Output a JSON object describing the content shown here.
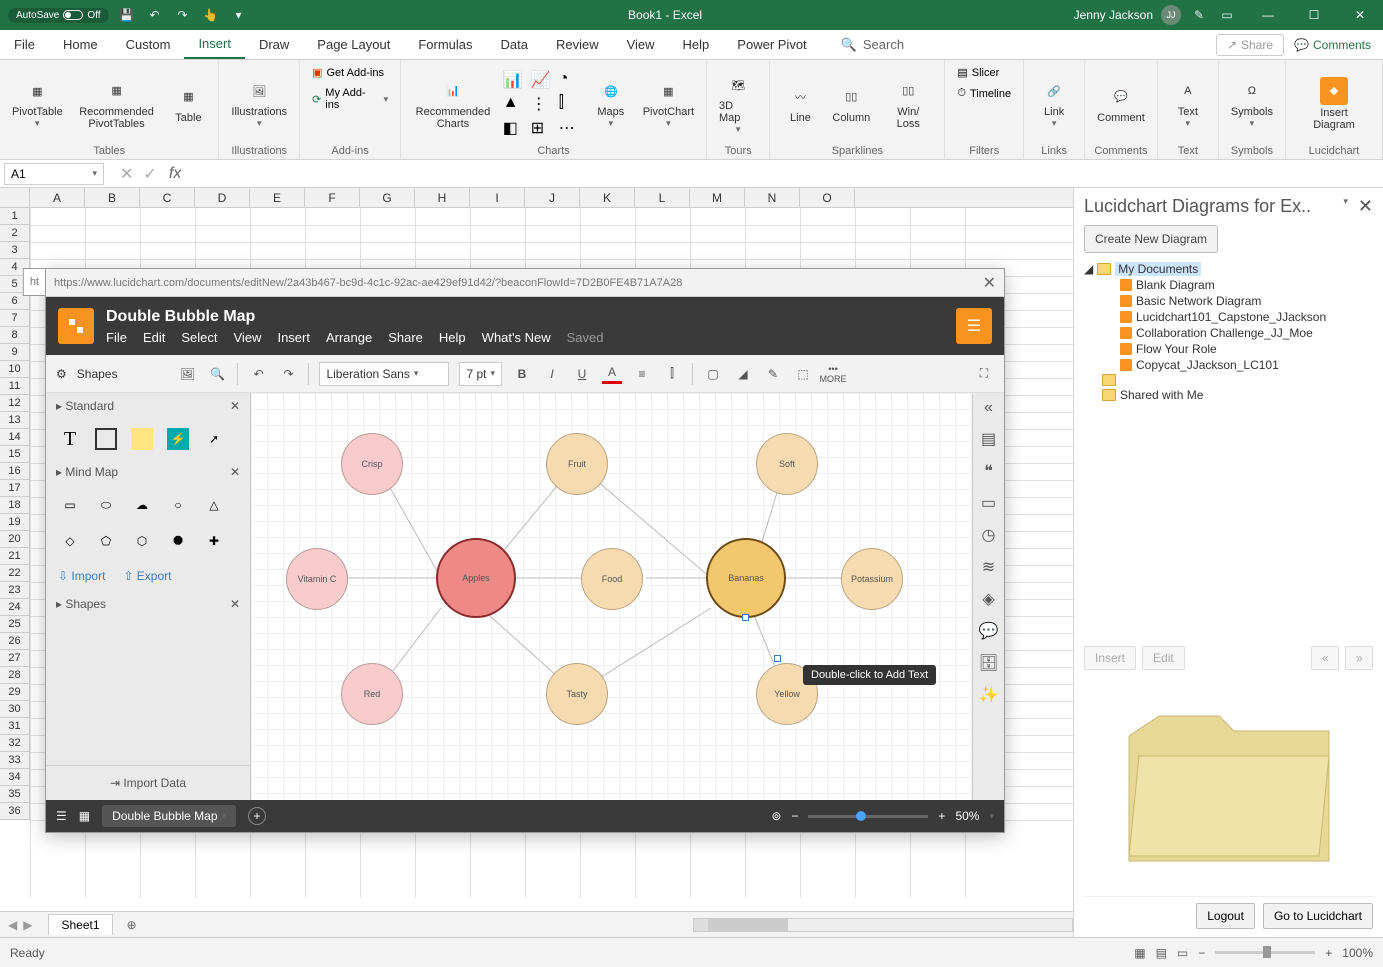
{
  "titlebar": {
    "autosave_label": "AutoSave",
    "autosave_state": "Off",
    "title": "Book1 - Excel",
    "user_name": "Jenny Jackson",
    "user_initials": "JJ"
  },
  "tabs": [
    "File",
    "Home",
    "Custom",
    "Insert",
    "Draw",
    "Page Layout",
    "Formulas",
    "Data",
    "Review",
    "View",
    "Help",
    "Power Pivot"
  ],
  "active_tab": "Insert",
  "search_label": "Search",
  "share_label": "Share",
  "comments_label": "Comments",
  "ribbon": {
    "tables": {
      "label": "Tables",
      "pivot": "PivotTable",
      "rec": "Recommended PivotTables",
      "table": "Table"
    },
    "illustrations": {
      "label": "Illustrations",
      "btn": "Illustrations"
    },
    "addins": {
      "label": "Add-ins",
      "get": "Get Add-ins",
      "my": "My Add-ins"
    },
    "charts": {
      "label": "Charts",
      "rec": "Recommended Charts",
      "maps": "Maps",
      "pivotchart": "PivotChart"
    },
    "tours": {
      "label": "Tours",
      "map": "3D Map"
    },
    "sparklines": {
      "label": "Sparklines",
      "line": "Line",
      "column": "Column",
      "winloss": "Win/ Loss"
    },
    "filters": {
      "label": "Filters",
      "slicer": "Slicer",
      "timeline": "Timeline"
    },
    "links": {
      "label": "Links",
      "link": "Link"
    },
    "comments": {
      "label": "Comments",
      "comment": "Comment"
    },
    "text": {
      "label": "Text",
      "text": "Text"
    },
    "symbols": {
      "label": "Symbols",
      "symbols": "Symbols"
    },
    "lucid": {
      "label": "Lucidchart",
      "insert": "Insert Diagram"
    }
  },
  "namebox": "A1",
  "columns": [
    "A",
    "B",
    "C",
    "D",
    "E",
    "F",
    "G",
    "H",
    "I",
    "J",
    "K",
    "L",
    "M",
    "N",
    "O"
  ],
  "rows": 36,
  "pane": {
    "title": "Lucidchart Diagrams for Ex..",
    "new_btn": "Create New Diagram",
    "tree": {
      "root": "My Documents",
      "docs": [
        "Blank Diagram",
        "Basic Network Diagram",
        "Lucidchart101_Capstone_JJackson",
        "Collaboration Challenge_JJ_Moe",
        "Flow Your Role",
        "Copycat_JJackson_LC101"
      ],
      "shared": "Shared with Me"
    },
    "insert_btn": "Insert",
    "edit_btn": "Edit",
    "prev": "«",
    "next": "»",
    "logout": "Logout",
    "goto": "Go to Lucidchart"
  },
  "lucid": {
    "url": "https://www.lucidchart.com/documents/editNew/2a43b467-bc9d-4c1c-92ac-ae429ef91d42/?beaconFlowId=7D2B0FE4B71A7A28",
    "left_label": "ht",
    "doc_title": "Double Bubble Map",
    "menus": [
      "File",
      "Edit",
      "Select",
      "View",
      "Insert",
      "Arrange",
      "Share",
      "Help",
      "What's New"
    ],
    "saved": "Saved",
    "shapes_label": "Shapes",
    "font": "Liberation Sans",
    "fontsize": "7 pt",
    "more": "MORE",
    "side": {
      "standard": "Standard",
      "mindmap": "Mind Map",
      "shapes": "Shapes",
      "import": "Import",
      "export": "Export",
      "import_data": "Import Data"
    },
    "bubbles": {
      "crisp": "Crisp",
      "fruit": "Fruit",
      "soft": "Soft",
      "vitc": "Vitamin C",
      "apples": "Apples",
      "food": "Food",
      "bananas": "Bananas",
      "potassium": "Potassium",
      "red": "Red",
      "tasty": "Tasty",
      "yellow": "Yellow"
    },
    "tooltip": "Double-click to Add Text",
    "footer_title": "Double Bubble Map",
    "zoom": "50%"
  },
  "sheet": "Sheet1",
  "status": {
    "ready": "Ready",
    "zoom": "100%"
  }
}
